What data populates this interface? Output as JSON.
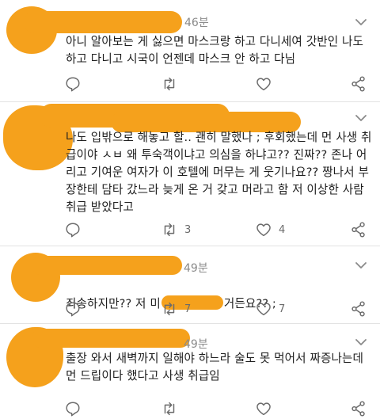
{
  "tweets": [
    {
      "time": "46분",
      "text": "아니 알아보는 게 싫으면 마스크랑 하고 다니세여 갓반인 나도 하고 다니고 시국이 언젠데 마스크 안 하고 다님",
      "retweets": "",
      "likes": ""
    },
    {
      "time": "",
      "text": "나도 입밖으로 해놓고 할.. 괜히 말했나 ; 후회했는데 먼 사생 취급이야 ㅅㅂ 왜 투숙객이냐고 의심을 하냐고?? 진짜?? 존나 어리고 기여운 여자가 이 호텔에 머무는 게 웃기나요?? 짱나서 부장한테 담타 갔느라 늦게 온 거 갖고 머라고 함 저 이상한 사람 취급 받았다고",
      "retweets": "3",
      "likes": "4"
    },
    {
      "time": "49분",
      "text": "죄송하지만?? 저 미",
      "text_tail": "거든요?? ;",
      "retweets": "7",
      "likes": "7"
    },
    {
      "time": "49분",
      "text": "출장 와서 새벽까지 일해야 하느라 술도 못 먹어서 짜증나는데 먼 드립이다 했다고 사생 취급임",
      "retweets": "",
      "likes": ""
    }
  ],
  "icons": {
    "reply": "reply-icon",
    "retweet": "retweet-icon",
    "like": "heart-icon",
    "share": "share-icon"
  },
  "colors": {
    "redaction": "#f5a11c",
    "icon": "#6b6b6b",
    "time": "#8a8a8a"
  }
}
